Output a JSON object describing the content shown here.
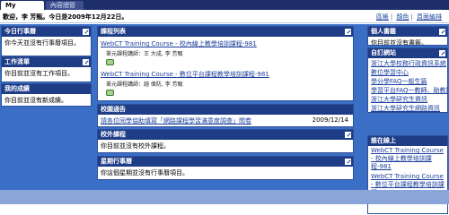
{
  "tabs": [
    {
      "label": "My WebCT"
    },
    {
      "label": "內容總管"
    }
  ],
  "header": {
    "user_info": "歡迎，李 芳甄。今日是2009年12月22日。",
    "links": [
      "區帳",
      "顏色",
      "頁面編排"
    ]
  },
  "left": {
    "today": {
      "title": "今日行事曆",
      "body": "你今天並沒有行事曆項目。"
    },
    "todo": {
      "title": "工作清單",
      "body": "你目前並沒有工作項目。"
    },
    "grades": {
      "title": "我的成績",
      "body": "你目前並沒有新成績。"
    }
  },
  "center": {
    "courses": {
      "title": "課程列表",
      "items": [
        {
          "name": "WebCT Training Course - 校內線上教學培訓課程-981",
          "instructor": "單元課程講師：王 大成, 李 芳甄"
        },
        {
          "name": "WebCT Training Course - 數位平台課程教學培訓課程-981",
          "instructor": "單元課程講師：趙 偉防, 李 芳甄"
        }
      ]
    },
    "news": {
      "title": "校園通告",
      "items": [
        {
          "text": "請各位同學協助填寫「網路課程學習滿意度調查」問卷",
          "date": "2009/12/14"
        }
      ]
    },
    "external": {
      "title": "校外課程",
      "body": "你目前並沒有校外課程。"
    },
    "week": {
      "title": "星期行事曆",
      "body": "你這個星期並沒有行事曆項目。"
    }
  },
  "right": {
    "bookmarks": {
      "title": "個人書籤",
      "body": "你目前並沒有書籤。"
    },
    "links": {
      "title": "自訂網站",
      "items": [
        "浙江大學校務行政資訊系統",
        "數位學習中心",
        "學分學FAQ一般生篇",
        "學習平台FAQ一教師、助教篇",
        "浙江大學研究生資訊",
        "浙江大學研究生網路資訊"
      ]
    },
    "online": {
      "title": "誰在線上",
      "items": [
        "WebCT Training Course - 校內線上教學培訓課程-981",
        "WebCT Training Course - 數位平台課程教學培訓課程-981"
      ]
    }
  }
}
